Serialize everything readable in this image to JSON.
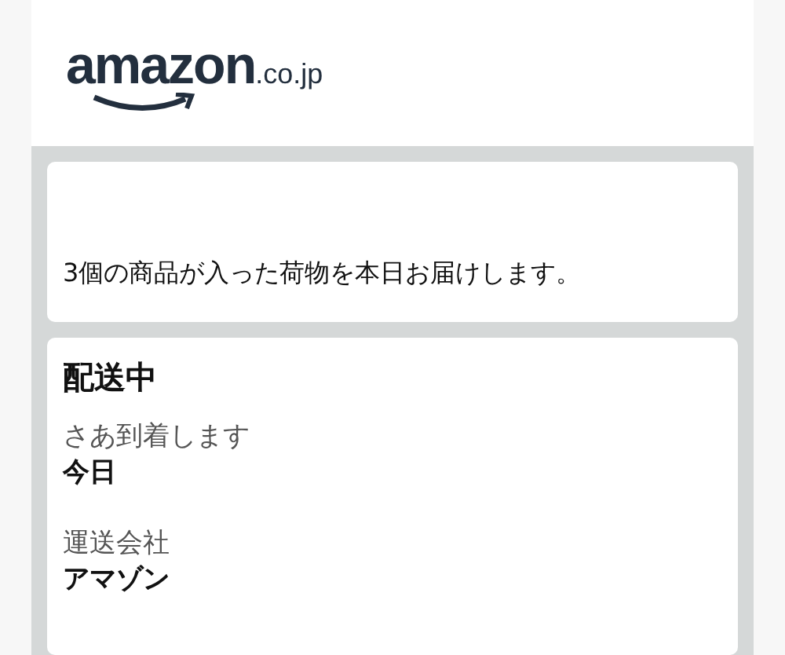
{
  "logo": {
    "name": "amazon",
    "domain": ".co.jp"
  },
  "summary": "3個の商品が入った荷物を本日お届けします。",
  "shipment": {
    "status": "配送中",
    "fields": [
      {
        "label": "さあ到着します",
        "value": "今日"
      },
      {
        "label": "運送会社",
        "value": "アマゾン"
      }
    ]
  }
}
